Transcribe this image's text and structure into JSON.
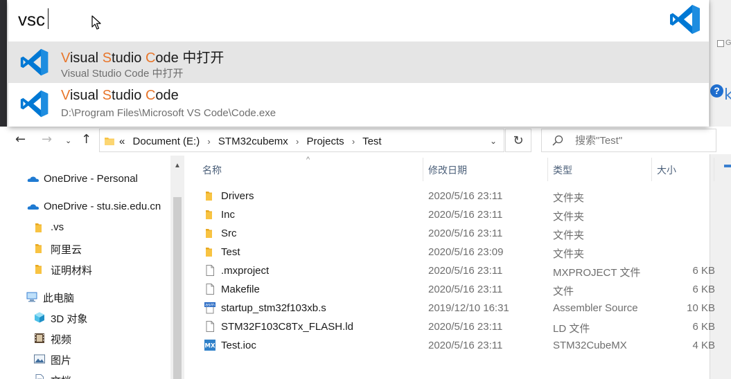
{
  "colors": {
    "accent_match": "#e8762b",
    "vscode_blue": "#0078d4",
    "folder_yellow": "#f8c342",
    "selected_row_bg": "#e5e5e5"
  },
  "launcher": {
    "query": "vsc",
    "results": [
      {
        "title_parts": [
          {
            "t": "V",
            "hl": true
          },
          {
            "t": "isual ",
            "hl": false
          },
          {
            "t": "S",
            "hl": true
          },
          {
            "t": "tudio ",
            "hl": false
          },
          {
            "t": "C",
            "hl": true
          },
          {
            "t": "ode 中打开",
            "hl": false
          }
        ],
        "subtitle": "Visual Studio Code 中打开",
        "icon": "vscode-icon",
        "selected": true
      },
      {
        "title_parts": [
          {
            "t": "V",
            "hl": true
          },
          {
            "t": "isual ",
            "hl": false
          },
          {
            "t": "S",
            "hl": true
          },
          {
            "t": "tudio ",
            "hl": false
          },
          {
            "t": "C",
            "hl": true
          },
          {
            "t": "ode",
            "hl": false
          }
        ],
        "subtitle": "D:\\Program Files\\Microsoft VS Code\\Code.exe",
        "icon": "vscode-icon",
        "selected": false
      }
    ]
  },
  "background_window": {
    "checkbox_text": "G",
    "help_glyph": "?",
    "letter": "k"
  },
  "explorer": {
    "nav_buttons": {
      "back": "←",
      "forward": "→",
      "recent": "⌄",
      "up": "↑",
      "refresh": "↻",
      "dropdown": "⌄"
    },
    "breadcrumb": {
      "overflow": "«",
      "parts": [
        "Document (E:)",
        "STM32cubemx",
        "Projects",
        "Test"
      ],
      "separator": "›"
    },
    "search_placeholder": "搜索\"Test\"",
    "nav_pane": [
      {
        "label": "OneDrive - Personal",
        "icon": "onedrive-cloud-icon",
        "indent": 0
      },
      {
        "label": "OneDrive - stu.sie.edu.cn",
        "icon": "onedrive-cloud-icon",
        "indent": 0
      },
      {
        "label": ".vs",
        "icon": "folder-icon",
        "indent": 1
      },
      {
        "label": "阿里云",
        "icon": "folder-icon",
        "indent": 1
      },
      {
        "label": "证明材料",
        "icon": "folder-icon",
        "indent": 1
      },
      {
        "label": "此电脑",
        "icon": "this-pc-icon",
        "indent": 0
      },
      {
        "label": "3D 对象",
        "icon": "3d-objects-icon",
        "indent": 1
      },
      {
        "label": "视频",
        "icon": "videos-icon",
        "indent": 1
      },
      {
        "label": "图片",
        "icon": "pictures-icon",
        "indent": 1
      },
      {
        "label": "文档",
        "icon": "documents-icon",
        "indent": 1
      }
    ],
    "columns": {
      "name": "名称",
      "date": "修改日期",
      "type": "类型",
      "size": "大小",
      "sort_glyph": "^"
    },
    "files": [
      {
        "name": "Drivers",
        "date": "2020/5/16 23:11",
        "type": "文件夹",
        "size": "",
        "icon": "folder-icon"
      },
      {
        "name": "Inc",
        "date": "2020/5/16 23:11",
        "type": "文件夹",
        "size": "",
        "icon": "folder-icon"
      },
      {
        "name": "Src",
        "date": "2020/5/16 23:11",
        "type": "文件夹",
        "size": "",
        "icon": "folder-icon"
      },
      {
        "name": "Test",
        "date": "2020/5/16 23:09",
        "type": "文件夹",
        "size": "",
        "icon": "folder-icon"
      },
      {
        "name": ".mxproject",
        "date": "2020/5/16 23:11",
        "type": "MXPROJECT 文件",
        "size": "6 KB",
        "icon": "file-icon"
      },
      {
        "name": "Makefile",
        "date": "2020/5/16 23:11",
        "type": "文件",
        "size": "6 KB",
        "icon": "file-icon"
      },
      {
        "name": "startup_stm32f103xb.s",
        "date": "2019/12/10 16:31",
        "type": "Assembler Source",
        "size": "10 KB",
        "icon": "asm-file-icon"
      },
      {
        "name": "STM32F103C8Tx_FLASH.ld",
        "date": "2020/5/16 23:11",
        "type": "LD 文件",
        "size": "6 KB",
        "icon": "file-icon"
      },
      {
        "name": "Test.ioc",
        "date": "2020/5/16 23:11",
        "type": "STM32CubeMX",
        "size": "4 KB",
        "icon": "stm32cubemx-icon"
      }
    ],
    "asm_badge": "asm",
    "mx_badge": "MX"
  }
}
